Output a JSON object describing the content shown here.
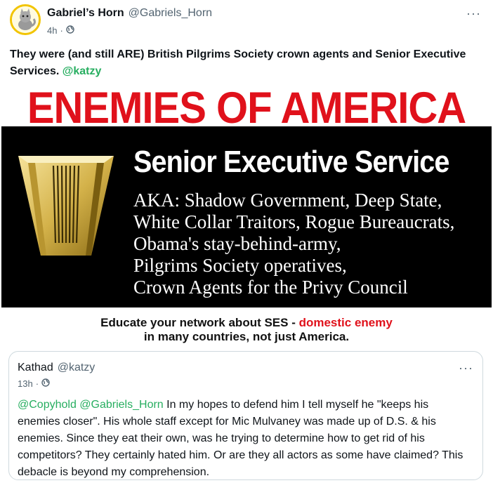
{
  "post": {
    "display_name": "Gabriel’s Horn",
    "handle": "@Gabriels_Horn",
    "time": "4h",
    "separator": "·",
    "more": "···",
    "text": "They were (and still ARE) British Pilgrims Society crown agents and Senior Executive Services.",
    "mention": "@katzy"
  },
  "image": {
    "banner_title": "ENEMIES OF AMERICA",
    "panel_title": "Senior Executive Service",
    "aka_lines": [
      "AKA: Shadow Government, Deep State,",
      "White Collar Traitors, Rogue Bureaucrats,",
      "Obama's stay-behind-army,",
      "Pilgrims Society operatives,",
      "Crown Agents for the Privy Council"
    ],
    "educate_line1": "Educate your network about SES - ",
    "educate_red": "domestic enemy",
    "educate_line2": "in many countries, not just America.",
    "colors": {
      "title_red": "#e0111b",
      "panel": "#000000",
      "emblem_gold": "#d4b24a"
    }
  },
  "quote": {
    "display_name": "Kathad",
    "handle": "@katzy",
    "time": "13h",
    "separator": "·",
    "more": "···",
    "mentions": "@Copyhold @Gabriels_Horn",
    "text": "In my hopes to defend him I tell myself he \"keeps his enemies closer\". His whole staff except for Mic Mulvaney was made up of D.S. & his enemies. Since they eat their own, was he trying to determine how to get rid of his competitors? They certainly hated him. Or are they all actors as some have claimed? This debacle is beyond my comprehension."
  },
  "icons": {
    "visibility": "globe-icon",
    "menu": "more-horizontal-icon"
  },
  "accent_color": "#27ae60"
}
